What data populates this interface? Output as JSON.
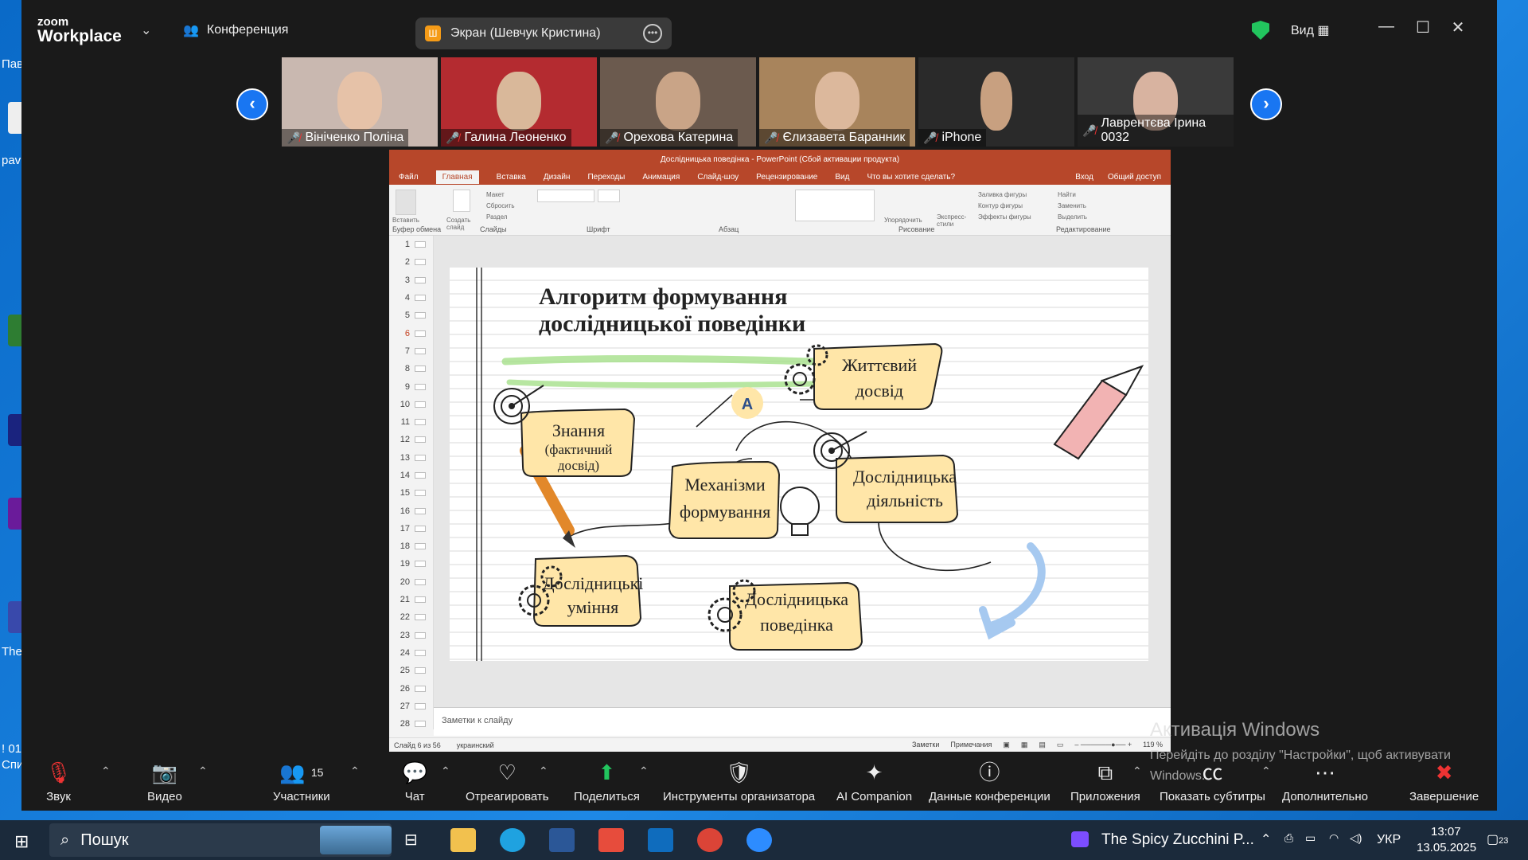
{
  "zoom": {
    "logo_small": "zoom",
    "logo_big": "Workplace",
    "conference_label": "Конференция",
    "share_label": "Экран (Шевчук Кристина)",
    "share_badge": "Ш",
    "view_label": "Вид",
    "participants": [
      {
        "name": "Вініченко Поліна"
      },
      {
        "name": "Галина Леоненко"
      },
      {
        "name": "Орехова Катерина"
      },
      {
        "name": "Єлизавета Баранник"
      },
      {
        "name": "iPhone"
      },
      {
        "name": "Лаврентєва Ірина 0032"
      }
    ],
    "toolbar": {
      "audio": "Звук",
      "video": "Видео",
      "participants": "Участники",
      "participants_count": "15",
      "chat": "Чат",
      "react": "Отреагировать",
      "share": "Поделиться",
      "host_tools": "Инструменты организатора",
      "ai": "AI Companion",
      "info": "Данные конференции",
      "apps": "Приложения",
      "captions": "Показать субтитры",
      "more": "Дополнительно",
      "end": "Завершение"
    }
  },
  "ppt": {
    "title": "Дослідницька поведінка - PowerPoint (Сбой активации продукта)",
    "tabs": [
      "Файл",
      "Главная",
      "Вставка",
      "Дизайн",
      "Переходы",
      "Анимация",
      "Слайд-шоу",
      "Рецензирование",
      "Вид",
      "Что вы хотите сделать?"
    ],
    "tabs_right": [
      "Вход",
      "Общий доступ"
    ],
    "ribbon_groups": [
      "Буфер обмена",
      "Слайды",
      "Шрифт",
      "Абзац",
      "Рисование",
      "Редактирование"
    ],
    "ribbon_items": {
      "paste": "Вставить",
      "new_slide": "Создать слайд",
      "layout": "Макет",
      "reset": "Сбросить",
      "section": "Раздел",
      "arrange": "Упорядочить",
      "quick_styles": "Экспресс-стили",
      "fill": "Заливка фигуры",
      "outline": "Контур фигуры",
      "effects": "Эффекты фигуры",
      "find": "Найти",
      "replace": "Заменить",
      "select": "Выделить"
    },
    "slide_numbers": [
      "1",
      "2",
      "3",
      "4",
      "5",
      "6",
      "7",
      "8",
      "9",
      "10",
      "11",
      "12",
      "13",
      "14",
      "15",
      "16",
      "17",
      "18",
      "19",
      "20",
      "21",
      "22",
      "23",
      "24",
      "25",
      "26",
      "27",
      "28"
    ],
    "active_slide": 6,
    "slide": {
      "title_line1": "Алгоритм формування",
      "title_line2": "дослідницької поведінки",
      "box_knowledge_1": "Знання",
      "box_knowledge_2": "(фактичний",
      "box_knowledge_3": "досвід)",
      "box_life_1": "Життєвий",
      "box_life_2": "досвід",
      "box_mech_1": "Механізми",
      "box_mech_2": "формування",
      "box_activity_1": "Дослідницька",
      "box_activity_2": "діяльність",
      "box_skills_1": "Дослідницькі",
      "box_skills_2": "уміння",
      "box_behavior_1": "Дослідницька",
      "box_behavior_2": "поведінка",
      "badge_letter": "A"
    },
    "notes_placeholder": "Заметки к слайду",
    "status_left": "Слайд 6 из 56",
    "status_lang": "украинский",
    "status_notes": "Заметки",
    "status_comments": "Примечания",
    "zoom_level": "119 %"
  },
  "watermark": {
    "line1": "Активація Windows",
    "line2": "Перейдіть до розділу \"Настройки\", щоб активувати Windows."
  },
  "taskbar": {
    "search": "Пошук",
    "media": "The Spicy Zucchini P...",
    "lang": "УКР",
    "time": "13:07",
    "date": "13.05.2025",
    "notif_count": "23"
  },
  "desktop": {
    "labels": [
      "Пав",
      "pav",
      "The",
      "! 01",
      "Спи"
    ]
  },
  "colors": {
    "zoom_bg": "#1a1a1a",
    "ppt_accent": "#b7472a",
    "box_fill": "#ffe6a8",
    "taskbar": "#1b2a3b",
    "desktop": "#0a6ac8"
  }
}
